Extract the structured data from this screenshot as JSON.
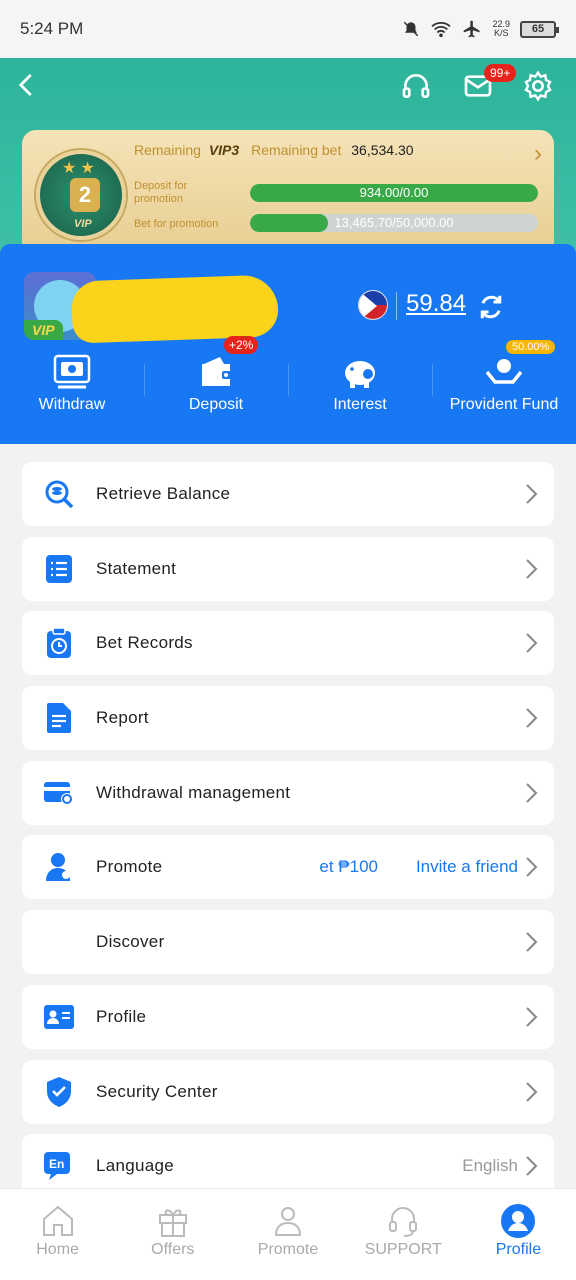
{
  "status_bar": {
    "time": "5:24 PM",
    "net_speed": "22.9",
    "net_unit": "K/S",
    "battery": "65"
  },
  "header": {
    "notification_badge": "99+"
  },
  "vip": {
    "level": "2",
    "medal_text": "VIP",
    "remaining_label": "Remaining",
    "next_level": "VIP3",
    "remaining_bet_label": "Remaining bet",
    "remaining_bet_value": "36,534.30",
    "deposit_label": "Deposit for promotion",
    "deposit_value": "934.00/0.00",
    "deposit_progress": 1.0,
    "bet_label": "Bet for promotion",
    "bet_value": "13,465.70/50,000.00",
    "bet_progress": 0.27
  },
  "user": {
    "vip_tag": "VIP",
    "balance": "59.84"
  },
  "actions": [
    {
      "label": "Withdraw",
      "icon": "withdraw-icon"
    },
    {
      "label": "Deposit",
      "icon": "wallet-icon",
      "badge": "+2%"
    },
    {
      "label": "Interest",
      "icon": "piggy-bank-icon"
    },
    {
      "label": "Provident Fund",
      "icon": "hands-coin-icon",
      "badge": "50.00%"
    }
  ],
  "menu": [
    {
      "label": "Retrieve Balance",
      "icon": "retrieve-icon"
    },
    {
      "label": "Statement",
      "icon": "list-icon"
    },
    {
      "label": "Bet Records",
      "icon": "clock-clipboard-icon"
    },
    {
      "label": "Report",
      "icon": "document-icon"
    },
    {
      "label": "Withdrawal management",
      "icon": "card-gear-icon"
    },
    {
      "label": "Promote",
      "icon": "person-icon",
      "marquee": "et ₱100",
      "extra": "Invite a friend"
    },
    {
      "label": "Discover",
      "icon": ""
    },
    {
      "label": "Profile",
      "icon": "id-card-icon"
    },
    {
      "label": "Security Center",
      "icon": "shield-icon"
    },
    {
      "label": "Language",
      "icon": "language-icon",
      "extra": "English"
    }
  ],
  "nav": [
    {
      "label": "Home",
      "icon": "home-icon"
    },
    {
      "label": "Offers",
      "icon": "gift-icon"
    },
    {
      "label": "Promote",
      "icon": "promote-icon"
    },
    {
      "label": "SUPPORT",
      "icon": "headset-icon"
    },
    {
      "label": "Profile",
      "icon": "profile-icon",
      "active": true
    }
  ],
  "colors": {
    "primary": "#1877f2",
    "header_green": "#2db49b",
    "progress_green": "#39a948",
    "vip_gold": "#c09030"
  }
}
